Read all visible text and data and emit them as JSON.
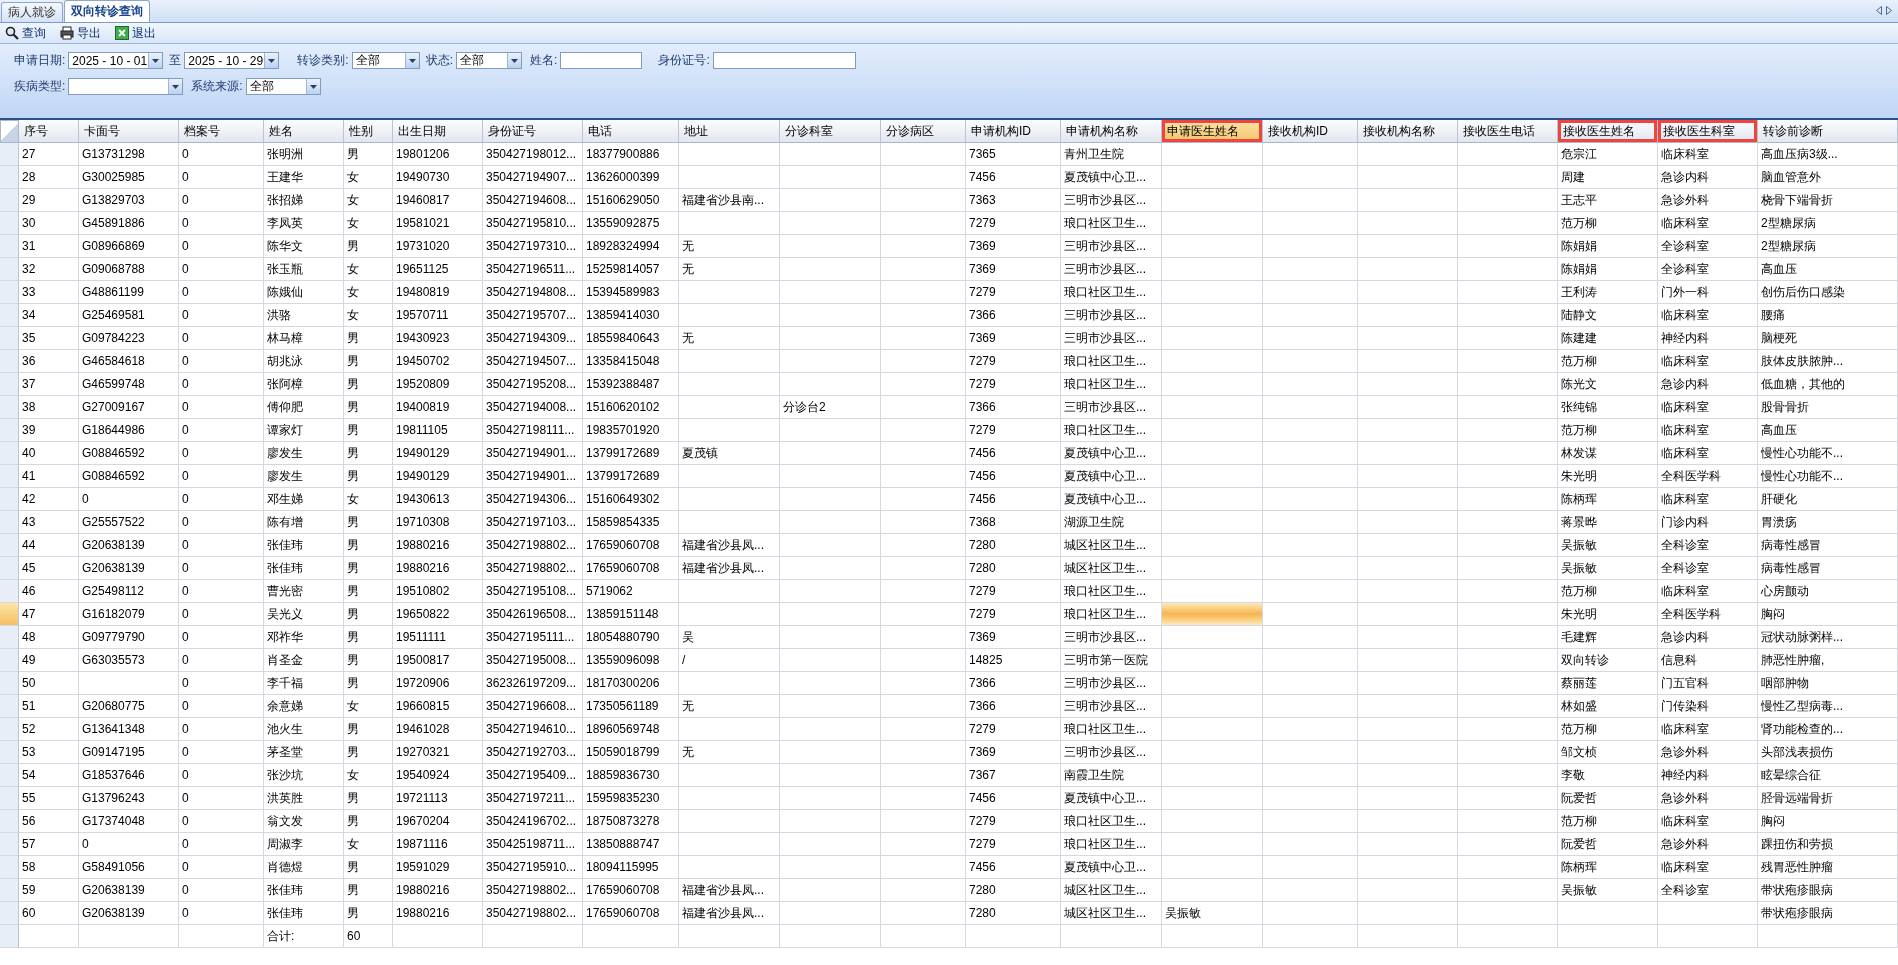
{
  "tabs": [
    {
      "label": "病人就诊",
      "selected": false
    },
    {
      "label": "双向转诊查询",
      "selected": true
    }
  ],
  "toolbar": [
    {
      "label": "查询",
      "kind": "search"
    },
    {
      "label": "导出",
      "kind": "print"
    },
    {
      "label": "退出",
      "kind": "exit"
    }
  ],
  "filter_rows": [
    {
      "fields": [
        {
          "label": "申请日期:",
          "kind": "date",
          "value": "2025 - 10 - 01"
        },
        {
          "label": "至",
          "kind": "date",
          "value": "2025 - 10 - 29"
        },
        {
          "label": "转诊类别:",
          "kind": "select",
          "value": "全部"
        },
        {
          "label": "状态:",
          "kind": "select",
          "value": "全部"
        },
        {
          "label": "姓名:",
          "kind": "text"
        },
        {
          "label": "身份证号:",
          "kind": "text"
        }
      ]
    },
    {
      "fields": [
        {
          "label": "疾病类型:",
          "kind": "select"
        },
        {
          "label": "系统来源:",
          "kind": "select",
          "value": "全部"
        }
      ]
    }
  ],
  "table": {
    "columns": [
      {
        "label": "序号",
        "selected": false,
        "outlined": false
      },
      {
        "label": "卡面号",
        "selected": false,
        "outlined": false
      },
      {
        "label": "档案号",
        "selected": false,
        "outlined": false
      },
      {
        "label": "姓名",
        "selected": false,
        "outlined": false
      },
      {
        "label": "性别",
        "selected": false,
        "outlined": false
      },
      {
        "label": "出生日期",
        "selected": false,
        "outlined": false
      },
      {
        "label": "身份证号",
        "selected": false,
        "outlined": false
      },
      {
        "label": "电话",
        "selected": false,
        "outlined": false
      },
      {
        "label": "地址",
        "selected": false,
        "outlined": false
      },
      {
        "label": "分诊科室",
        "selected": false,
        "outlined": false
      },
      {
        "label": "分诊病区",
        "selected": false,
        "outlined": false
      },
      {
        "label": "申请机构ID",
        "selected": false,
        "outlined": false
      },
      {
        "label": "申请机构名称",
        "selected": false,
        "outlined": false
      },
      {
        "label": "申请医生姓名",
        "selected": true,
        "outlined": true
      },
      {
        "label": "接收机构ID",
        "selected": false,
        "outlined": false
      },
      {
        "label": "接收机构名称",
        "selected": false,
        "outlined": false
      },
      {
        "label": "接收医生电话",
        "selected": false,
        "outlined": false
      },
      {
        "label": "接收医生姓名",
        "selected": false,
        "outlined": true
      },
      {
        "label": "接收医生科室",
        "selected": false,
        "outlined": true
      },
      {
        "label": "转诊前诊断",
        "selected": false,
        "outlined": false
      }
    ],
    "rows": [
      {
        "selected": false,
        "no": "27",
        "card": "G13731298",
        "file": "0",
        "name": "张明洲",
        "sex": "男",
        "birth": "19801206",
        "idno": "350427198012...",
        "phone": "18377900886",
        "req_org_id": "7365",
        "req_org": "青州卫生院",
        "recv_doctor": "危宗江",
        "recv_dept": "临床科室",
        "diagnosis": "高血压病3级..."
      },
      {
        "selected": false,
        "no": "28",
        "card": "G30025985",
        "file": "0",
        "name": "王建华",
        "sex": "女",
        "birth": "19490730",
        "idno": "350427194907...",
        "phone": "13626000399",
        "req_org_id": "7456",
        "req_org": "夏茂镇中心卫...",
        "recv_doctor": "周建",
        "recv_dept": "急诊内科",
        "diagnosis": "脑血管意外"
      },
      {
        "selected": false,
        "no": "29",
        "card": "G13829703",
        "file": "0",
        "name": "张招娣",
        "sex": "女",
        "birth": "19460817",
        "idno": "350427194608...",
        "phone": "15160629050",
        "addr": "福建省沙县南...",
        "req_org_id": "7363",
        "req_org": "三明市沙县区...",
        "recv_doctor": "王志平",
        "recv_dept": "急诊外科",
        "diagnosis": "桡骨下端骨折"
      },
      {
        "selected": false,
        "no": "30",
        "card": "G45891886",
        "file": "0",
        "name": "李凤英",
        "sex": "女",
        "birth": "19581021",
        "idno": "350427195810...",
        "phone": "13559092875",
        "req_org_id": "7279",
        "req_org": "琅口社区卫生...",
        "recv_doctor": "范万柳",
        "recv_dept": "临床科室",
        "diagnosis": "2型糖尿病"
      },
      {
        "selected": false,
        "no": "31",
        "card": "G08966869",
        "file": "0",
        "name": "陈华文",
        "sex": "男",
        "birth": "19731020",
        "idno": "350427197310...",
        "phone": "18928324994",
        "addr": "无",
        "req_org_id": "7369",
        "req_org": "三明市沙县区...",
        "recv_doctor": "陈娟娟",
        "recv_dept": "全诊科室",
        "diagnosis": "2型糖尿病"
      },
      {
        "selected": false,
        "no": "32",
        "card": "G09068788",
        "file": "0",
        "name": "张玉瓶",
        "sex": "女",
        "birth": "19651125",
        "idno": "350427196511...",
        "phone": "15259814057",
        "addr": "无",
        "req_org_id": "7369",
        "req_org": "三明市沙县区...",
        "recv_doctor": "陈娟娟",
        "recv_dept": "全诊科室",
        "diagnosis": "高血压"
      },
      {
        "selected": false,
        "no": "33",
        "card": "G48861199",
        "file": "0",
        "name": "陈娥仙",
        "sex": "女",
        "birth": "19480819",
        "idno": "350427194808...",
        "phone": "15394589983",
        "req_org_id": "7279",
        "req_org": "琅口社区卫生...",
        "recv_doctor": "王利涛",
        "recv_dept": "门外一科",
        "diagnosis": "创伤后伤口感染"
      },
      {
        "selected": false,
        "no": "34",
        "card": "G25469581",
        "file": "0",
        "name": "洪骆",
        "sex": "女",
        "birth": "19570711",
        "idno": "350427195707...",
        "phone": "13859414030",
        "req_org_id": "7366",
        "req_org": "三明市沙县区...",
        "recv_doctor": "陆静文",
        "recv_dept": "临床科室",
        "diagnosis": "腰痛"
      },
      {
        "selected": false,
        "no": "35",
        "card": "G09784223",
        "file": "0",
        "name": "林马樟",
        "sex": "男",
        "birth": "19430923",
        "idno": "350427194309...",
        "phone": "18559840643",
        "addr": "无",
        "req_org_id": "7369",
        "req_org": "三明市沙县区...",
        "recv_doctor": "陈建建",
        "recv_dept": "神经内科",
        "diagnosis": "脑梗死"
      },
      {
        "selected": false,
        "no": "36",
        "card": "G46584618",
        "file": "0",
        "name": "胡兆泳",
        "sex": "男",
        "birth": "19450702",
        "idno": "350427194507...",
        "phone": "13358415048",
        "req_org_id": "7279",
        "req_org": "琅口社区卫生...",
        "recv_doctor": "范万柳",
        "recv_dept": "临床科室",
        "diagnosis": "肢体皮肤脓肿..."
      },
      {
        "selected": false,
        "no": "37",
        "card": "G46599748",
        "file": "0",
        "name": "张阿樟",
        "sex": "男",
        "birth": "19520809",
        "idno": "350427195208...",
        "phone": "15392388487",
        "req_org_id": "7279",
        "req_org": "琅口社区卫生...",
        "recv_doctor": "陈光文",
        "recv_dept": "急诊内科",
        "diagnosis": "低血糖，其他的"
      },
      {
        "selected": false,
        "no": "38",
        "card": "G27009167",
        "file": "0",
        "name": "傅仰肥",
        "sex": "男",
        "birth": "19400819",
        "idno": "350427194008...",
        "phone": "15160620102",
        "triage": "分诊台2",
        "req_org_id": "7366",
        "req_org": "三明市沙县区...",
        "recv_doctor": "张纯锦",
        "recv_dept": "临床科室",
        "diagnosis": "股骨骨折"
      },
      {
        "selected": false,
        "no": "39",
        "card": "G18644986",
        "file": "0",
        "name": "谭家灯",
        "sex": "男",
        "birth": "19811105",
        "idno": "350427198111...",
        "phone": "19835701920",
        "req_org_id": "7279",
        "req_org": "琅口社区卫生...",
        "recv_doctor": "范万柳",
        "recv_dept": "临床科室",
        "diagnosis": "高血压"
      },
      {
        "selected": false,
        "no": "40",
        "card": "G08846592",
        "file": "0",
        "name": "廖发生",
        "sex": "男",
        "birth": "19490129",
        "idno": "350427194901...",
        "phone": "13799172689",
        "addr": "夏茂镇",
        "req_org_id": "7456",
        "req_org": "夏茂镇中心卫...",
        "recv_doctor": "林发谋",
        "recv_dept": "临床科室",
        "diagnosis": "慢性心功能不..."
      },
      {
        "selected": false,
        "no": "41",
        "card": "G08846592",
        "file": "0",
        "name": "廖发生",
        "sex": "男",
        "birth": "19490129",
        "idno": "350427194901...",
        "phone": "13799172689",
        "req_org_id": "7456",
        "req_org": "夏茂镇中心卫...",
        "recv_doctor": "朱光明",
        "recv_dept": "全科医学科",
        "diagnosis": "慢性心功能不..."
      },
      {
        "selected": false,
        "no": "42",
        "card": "0",
        "file": "0",
        "name": "邓生娣",
        "sex": "女",
        "birth": "19430613",
        "idno": "350427194306...",
        "phone": "15160649302",
        "req_org_id": "7456",
        "req_org": "夏茂镇中心卫...",
        "recv_doctor": "陈柄珲",
        "recv_dept": "临床科室",
        "diagnosis": "肝硬化"
      },
      {
        "selected": false,
        "no": "43",
        "card": "G25557522",
        "file": "0",
        "name": "陈有增",
        "sex": "男",
        "birth": "19710308",
        "idno": "350427197103...",
        "phone": "15859854335",
        "req_org_id": "7368",
        "req_org": "湖源卫生院",
        "recv_doctor": "蒋景晔",
        "recv_dept": "门诊内科",
        "diagnosis": "胃溃疡"
      },
      {
        "selected": false,
        "no": "44",
        "card": "G20638139",
        "file": "0",
        "name": "张佳玮",
        "sex": "男",
        "birth": "19880216",
        "idno": "350427198802...",
        "phone": "17659060708",
        "addr": "福建省沙县凤...",
        "req_org_id": "7280",
        "req_org": "城区社区卫生...",
        "recv_doctor": "吴振敏",
        "recv_dept": "全科诊室",
        "diagnosis": "病毒性感冒"
      },
      {
        "selected": false,
        "no": "45",
        "card": "G20638139",
        "file": "0",
        "name": "张佳玮",
        "sex": "男",
        "birth": "19880216",
        "idno": "350427198802...",
        "phone": "17659060708",
        "addr": "福建省沙县凤...",
        "req_org_id": "7280",
        "req_org": "城区社区卫生...",
        "recv_doctor": "吴振敏",
        "recv_dept": "全科诊室",
        "diagnosis": "病毒性感冒"
      },
      {
        "selected": false,
        "no": "46",
        "card": "G25498112",
        "file": "0",
        "name": "曹光密",
        "sex": "男",
        "birth": "19510802",
        "idno": "350427195108...",
        "phone": "5719062",
        "req_org_id": "7279",
        "req_org": "琅口社区卫生...",
        "recv_doctor": "范万柳",
        "recv_dept": "临床科室",
        "diagnosis": "心房颤动"
      },
      {
        "selected": true,
        "no": "47",
        "card": "G16182079",
        "file": "0",
        "name": "吴光义",
        "sex": "男",
        "birth": "19650822",
        "idno": "350426196508...",
        "phone": "13859151148",
        "req_org_id": "7279",
        "req_org": "琅口社区卫生...",
        "recv_doctor": "朱光明",
        "recv_dept": "全科医学科",
        "diagnosis": "胸闷"
      },
      {
        "selected": false,
        "no": "48",
        "card": "G09779790",
        "file": "0",
        "name": "邓祚华",
        "sex": "男",
        "birth": "19511111",
        "idno": "350427195111...",
        "phone": "18054880790",
        "addr": "吴",
        "req_org_id": "7369",
        "req_org": "三明市沙县区...",
        "recv_doctor": "毛建辉",
        "recv_dept": "急诊内科",
        "diagnosis": "冠状动脉粥样..."
      },
      {
        "selected": false,
        "no": "49",
        "card": "G63035573",
        "file": "0",
        "name": "肖圣金",
        "sex": "男",
        "birth": "19500817",
        "idno": "350427195008...",
        "phone": "13559096098",
        "addr": "/",
        "req_org_id": "14825",
        "req_org": "三明市第一医院",
        "recv_doctor": "双向转诊",
        "recv_dept": "信息科",
        "diagnosis": "肺恶性肿瘤,"
      },
      {
        "selected": false,
        "no": "50",
        "file": "0",
        "name": "李千福",
        "sex": "男",
        "birth": "19720906",
        "idno": "362326197209...",
        "phone": "18170300206",
        "req_org_id": "7366",
        "req_org": "三明市沙县区...",
        "recv_doctor": "蔡丽莲",
        "recv_dept": "门五官科",
        "diagnosis": "咽部肿物"
      },
      {
        "selected": false,
        "no": "51",
        "card": "G20680775",
        "file": "0",
        "name": "余意娣",
        "sex": "女",
        "birth": "19660815",
        "idno": "350427196608...",
        "phone": "17350561189",
        "addr": "无",
        "req_org_id": "7366",
        "req_org": "三明市沙县区...",
        "recv_doctor": "林如盛",
        "recv_dept": "门传染科",
        "diagnosis": "慢性乙型病毒..."
      },
      {
        "selected": false,
        "no": "52",
        "card": "G13641348",
        "file": "0",
        "name": "池火生",
        "sex": "男",
        "birth": "19461028",
        "idno": "350427194610...",
        "phone": "18960569748",
        "req_org_id": "7279",
        "req_org": "琅口社区卫生...",
        "recv_doctor": "范万柳",
        "recv_dept": "临床科室",
        "diagnosis": "肾功能检查的..."
      },
      {
        "selected": false,
        "no": "53",
        "card": "G09147195",
        "file": "0",
        "name": "茅圣堂",
        "sex": "男",
        "birth": "19270321",
        "idno": "350427192703...",
        "phone": "15059018799",
        "addr": "无",
        "req_org_id": "7369",
        "req_org": "三明市沙县区...",
        "recv_doctor": "邹文桢",
        "recv_dept": "急诊外科",
        "diagnosis": "头部浅表损伤"
      },
      {
        "selected": false,
        "no": "54",
        "card": "G18537646",
        "file": "0",
        "name": "张沙坑",
        "sex": "女",
        "birth": "19540924",
        "idno": "350427195409...",
        "phone": "18859836730",
        "req_org_id": "7367",
        "req_org": "南霞卫生院",
        "recv_doctor": "李敬",
        "recv_dept": "神经内科",
        "diagnosis": "眩晕综合征"
      },
      {
        "selected": false,
        "no": "55",
        "card": "G13796243",
        "file": "0",
        "name": "洪英胜",
        "sex": "男",
        "birth": "19721113",
        "idno": "350427197211...",
        "phone": "15959835230",
        "req_org_id": "7456",
        "req_org": "夏茂镇中心卫...",
        "recv_doctor": "阮爱哲",
        "recv_dept": "急诊外科",
        "diagnosis": "胫骨远端骨折"
      },
      {
        "selected": false,
        "no": "56",
        "card": "G17374048",
        "file": "0",
        "name": "翁文发",
        "sex": "男",
        "birth": "19670204",
        "idno": "350424196702...",
        "phone": "18750873278",
        "req_org_id": "7279",
        "req_org": "琅口社区卫生...",
        "recv_doctor": "范万柳",
        "recv_dept": "临床科室",
        "diagnosis": "胸闷"
      },
      {
        "selected": false,
        "no": "57",
        "card": "0",
        "file": "0",
        "name": "周淑李",
        "sex": "女",
        "birth": "19871116",
        "idno": "350425198711...",
        "phone": "13850888747",
        "req_org_id": "7279",
        "req_org": "琅口社区卫生...",
        "recv_doctor": "阮爱哲",
        "recv_dept": "急诊外科",
        "diagnosis": "踝扭伤和劳损"
      },
      {
        "selected": false,
        "no": "58",
        "card": "G58491056",
        "file": "0",
        "name": "肖德煜",
        "sex": "男",
        "birth": "19591029",
        "idno": "350427195910...",
        "phone": "18094115995",
        "req_org_id": "7456",
        "req_org": "夏茂镇中心卫...",
        "recv_doctor": "陈柄珲",
        "recv_dept": "临床科室",
        "diagnosis": "残胃恶性肿瘤"
      },
      {
        "selected": false,
        "no": "59",
        "card": "G20638139",
        "file": "0",
        "name": "张佳玮",
        "sex": "男",
        "birth": "19880216",
        "idno": "350427198802...",
        "phone": "17659060708",
        "addr": "福建省沙县凤...",
        "req_org_id": "7280",
        "req_org": "城区社区卫生...",
        "recv_doctor": "吴振敏",
        "recv_dept": "全科诊室",
        "diagnosis": "带状疱疹眼病"
      },
      {
        "selected": false,
        "no": "60",
        "card": "G20638139",
        "file": "0",
        "name": "张佳玮",
        "sex": "男",
        "birth": "19880216",
        "idno": "350427198802...",
        "phone": "17659060708",
        "addr": "福建省沙县凤...",
        "req_org_id": "7280",
        "req_org": "城区社区卫生...",
        "req_doctor": "吴振敏",
        "diagnosis": "带状疱疹眼病"
      }
    ],
    "summary": {
      "name": "合计:",
      "sex": "60"
    }
  }
}
